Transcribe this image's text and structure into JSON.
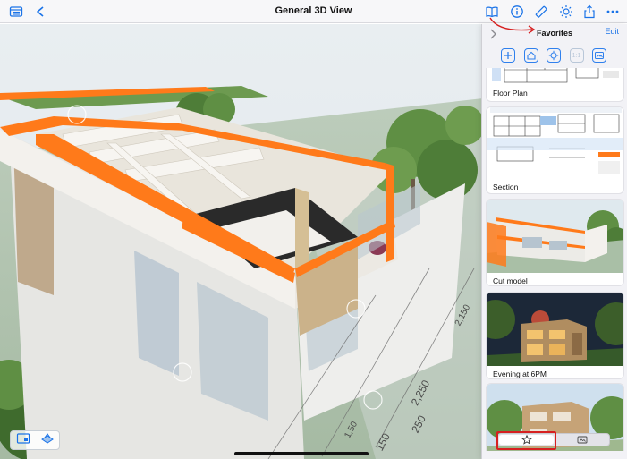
{
  "toolbar": {
    "title": "General 3D View",
    "left_icons": [
      "sidebar-icon",
      "back-arrow-icon"
    ],
    "right_icons": [
      "book-icon",
      "info-icon",
      "ruler-icon",
      "brightness-icon",
      "share-icon",
      "more-icon"
    ]
  },
  "panel": {
    "title": "Favorites",
    "edit_label": "Edit",
    "tools": [
      "add-icon",
      "home-icon",
      "fit-icon",
      "one-to-one-icon",
      "gallery-icon"
    ],
    "tool_text_one_to_one": "1:1",
    "items": [
      {
        "label": "Floor Plan"
      },
      {
        "label": "Section"
      },
      {
        "label": "Cut model"
      },
      {
        "label": "Evening at 6PM"
      },
      {
        "label": ""
      }
    ],
    "tabs": [
      {
        "name": "favorites",
        "icon": "star-icon",
        "selected": true
      },
      {
        "name": "views",
        "icon": "views-icon",
        "selected": false
      }
    ]
  },
  "viewport": {
    "dimension_labels": [
      "2,250",
      "250",
      "2,150",
      "1,50",
      "150"
    ]
  },
  "colors": {
    "accent": "#1a73e8",
    "cut_orange": "#ff7a1a",
    "highlight_red": "#d62020"
  }
}
